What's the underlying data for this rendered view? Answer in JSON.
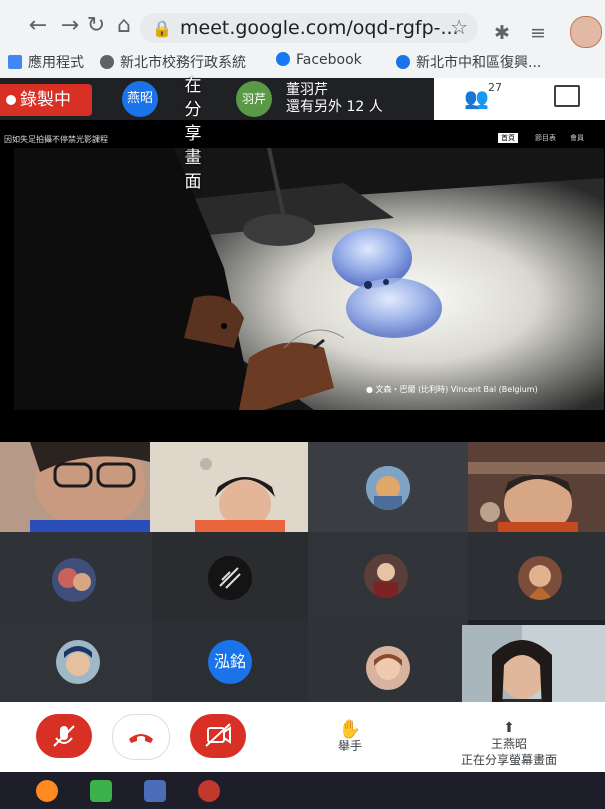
{
  "browser": {
    "url": "meet.google.com/oqd-rgfp-...",
    "bookmarks": [
      {
        "label": "應用程式",
        "icon": "apps-grid-icon",
        "color": "#4285f4"
      },
      {
        "label": "新北市校務行政系統",
        "icon": "globe-icon",
        "color": "#5f6368"
      },
      {
        "label": "Facebook",
        "icon": "facebook-icon",
        "color": "#1877f2"
      },
      {
        "label": "新北市中和區復興...",
        "icon": "site-icon",
        "color": "#1a73e8"
      }
    ]
  },
  "meet": {
    "recording_label": "錄製中",
    "chip_presenter": "燕昭",
    "presenting_vertical": "在分享畫面",
    "chip_other": "羽芹",
    "participant_name": "董羽芹",
    "participant_more": "還有另外 12 人",
    "people_count": "27",
    "caption": "因如失足拍攝不停禁光影課程",
    "tabs": [
      "首頁",
      "節目表",
      "會員"
    ],
    "credit": "● 文森・巴爾 (比利時) Vincent Bal (Belgium)"
  },
  "grid": {
    "avatar_text": "泓銘"
  },
  "controls": {
    "raise_hand": "舉手",
    "presenter_name": "王燕昭",
    "presenting_status": "正在分享螢幕畫面"
  },
  "colors": {
    "record_red": "#d93025",
    "meet_dark": "#202124",
    "chip_blue": "#1a73e8",
    "chip_green": "#5a9a46"
  }
}
